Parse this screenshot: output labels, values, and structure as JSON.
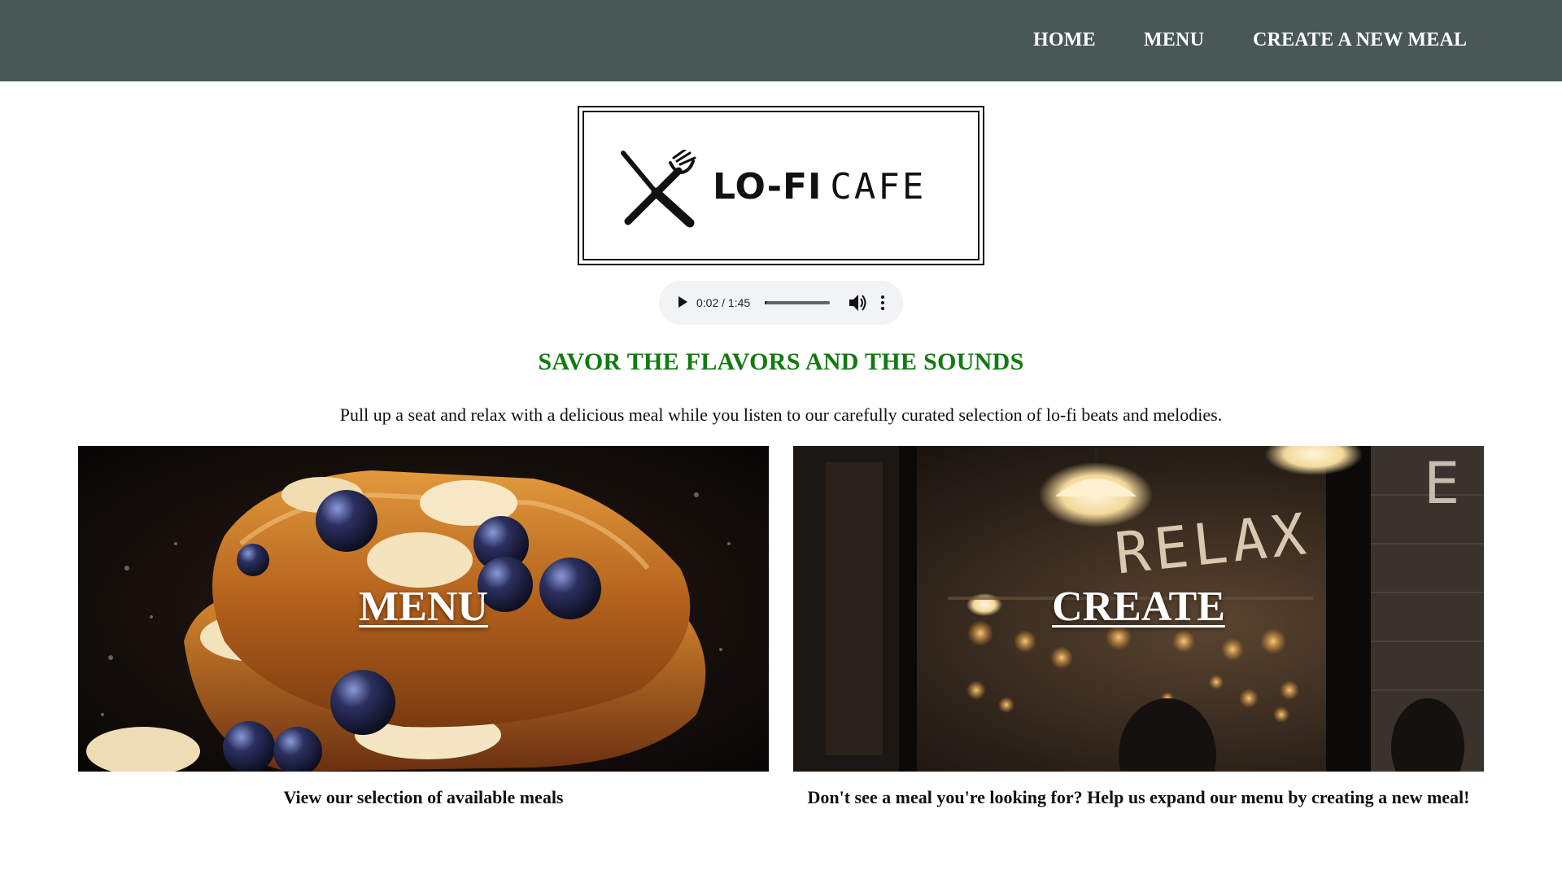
{
  "nav": {
    "home": "HOME",
    "menu": "MENU",
    "create": "CREATE A NEW MEAL",
    "bg_color": "#4a5757"
  },
  "logo": {
    "icon": "fork-and-knife-icon",
    "text_bold": "LO-FI",
    "text_light": "CAFE"
  },
  "audio": {
    "time": "0:02 / 1:45",
    "progress": 0.02,
    "play_icon": "play-icon",
    "volume_icon": "volume-icon",
    "more_icon": "more-vertical-icon"
  },
  "hero": {
    "tagline": "SAVOR THE FLAVORS AND THE SOUNDS",
    "tagline_color": "#117a11",
    "intro": "Pull up a seat and relax with a delicious meal while you listen to our carefully curated selection of lo-fi beats and melodies."
  },
  "cards": {
    "menu": {
      "title": "MENU",
      "caption": "View our selection of available meals"
    },
    "create": {
      "title": "CREATE",
      "sign_text": "RELAX",
      "caption": "Don't see a meal you're looking for? Help us expand our menu by creating a new meal!"
    }
  }
}
